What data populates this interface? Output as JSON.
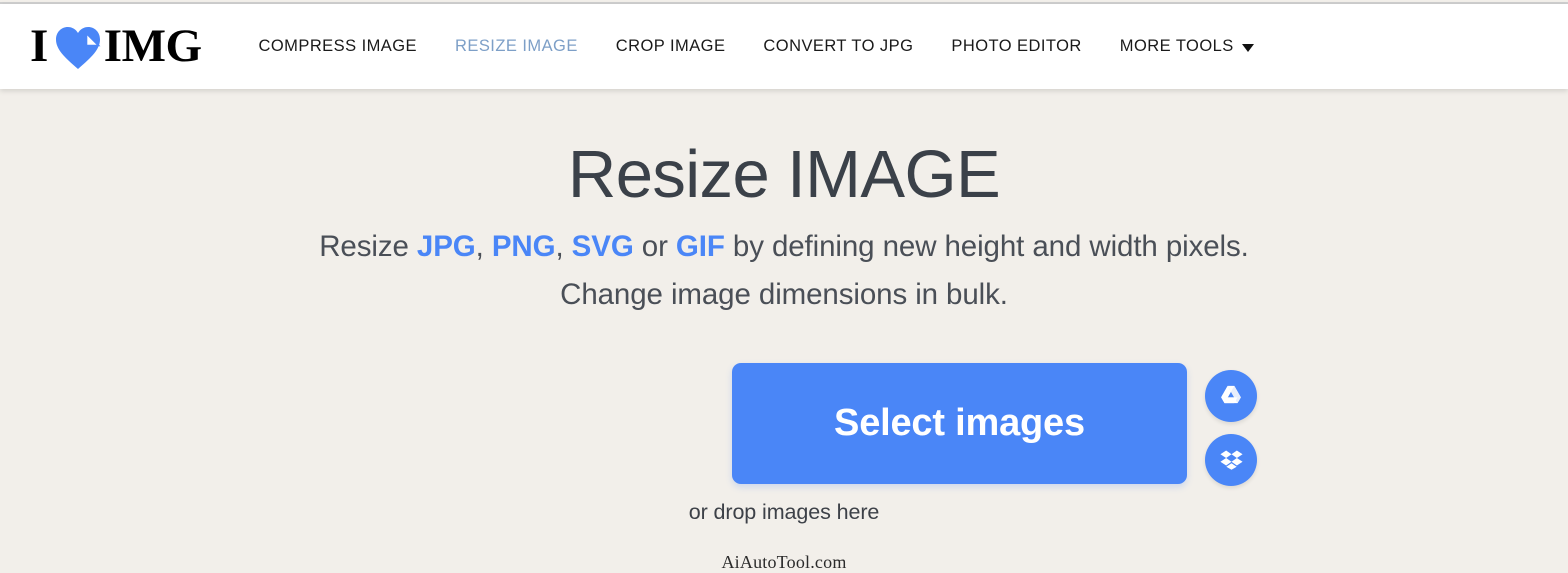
{
  "colors": {
    "page_background": "#f2efea",
    "header_background": "#ffffff",
    "accent_blue": "#4a86f7",
    "active_nav_blue": "#7d9fc7",
    "heading_text": "#3b4149",
    "body_text": "#4a4f57"
  },
  "header": {
    "logo": {
      "text_left": "I",
      "text_right": "IMG",
      "icon": "heart-image-icon",
      "alt": "I LOVE IMG"
    },
    "nav": [
      {
        "label": "COMPRESS IMAGE",
        "active": false
      },
      {
        "label": "RESIZE IMAGE",
        "active": true
      },
      {
        "label": "CROP IMAGE",
        "active": false
      },
      {
        "label": "CONVERT TO JPG",
        "active": false
      },
      {
        "label": "PHOTO EDITOR",
        "active": false
      },
      {
        "label": "MORE TOOLS",
        "active": false,
        "has_caret": true
      }
    ]
  },
  "main": {
    "title": "Resize IMAGE",
    "subtitle": {
      "lead": "Resize ",
      "formats": [
        {
          "label": "JPG",
          "separator": ", "
        },
        {
          "label": "PNG",
          "separator": ", "
        },
        {
          "label": "SVG",
          "separator": " or "
        },
        {
          "label": "GIF",
          "separator": " "
        }
      ],
      "tail_line1": "by defining new height and width pixels.",
      "line2": "Change image dimensions in bulk."
    },
    "select_button_label": "Select images",
    "cloud_buttons": [
      {
        "name": "google-drive",
        "icon": "google-drive-icon",
        "label": "Google Drive"
      },
      {
        "name": "dropbox",
        "icon": "dropbox-icon",
        "label": "Dropbox"
      }
    ],
    "drop_hint": "or drop images here"
  },
  "watermark": "AiAutoTool.com"
}
